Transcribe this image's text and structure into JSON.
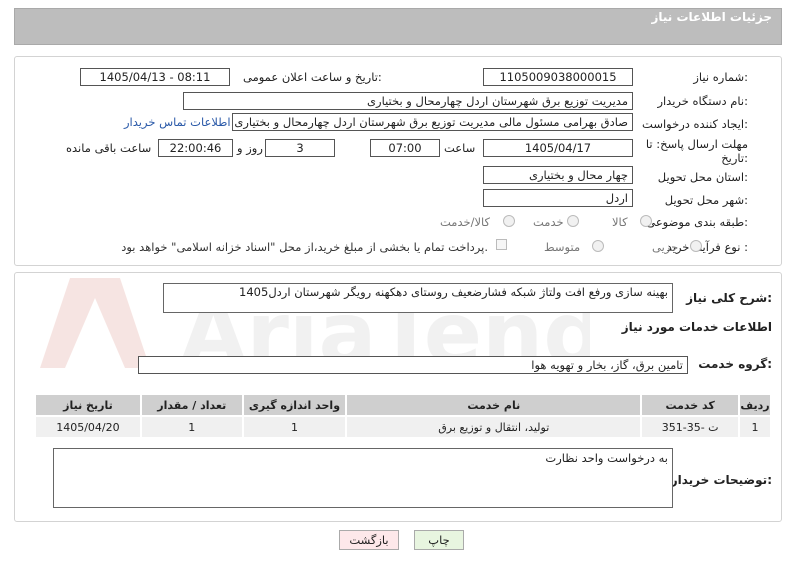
{
  "header": {
    "title": "جزئیات اطلاعات نیاز"
  },
  "watermark": {
    "text": "AriaTender.net"
  },
  "form": {
    "need_number_label": "شماره نیاز:",
    "need_number": "1105009038000015",
    "announce_label": "تاریخ و ساعت اعلان عمومی:",
    "announce_value": "1405/04/13 - 08:11",
    "buyer_org_label": "نام دستگاه خریدار:",
    "buyer_org": "مدیریت توزیع برق شهرستان اردل چهارمحال و بختیاری",
    "creator_label": "ایجاد کننده درخواست:",
    "creator": "صادق بهرامی مسئول مالی مدیریت توزیع برق شهرستان اردل چهارمحال و بختیاری",
    "contact_link": "اطلاعات تماس خریدار",
    "deadline_label": "مهلت ارسال پاسخ: تا تاریخ:",
    "deadline_date": "1405/04/17",
    "time_label": "ساعت",
    "deadline_time": "07:00",
    "days_value": "3",
    "days_label": "روز و",
    "remaining_time": "22:00:46",
    "remaining_label": "ساعت باقی مانده",
    "province_label": "استان محل تحویل:",
    "province": "چهار محال و بختیاری",
    "city_label": "شهر محل تحویل:",
    "city": "اردل",
    "category_label": "طبقه بندی موضوعی:",
    "category_options": [
      "کالا",
      "خدمت",
      "کالا/خدمت"
    ],
    "process_label": "نوع فرآیند خرید :",
    "process_options": [
      "جزیی",
      "متوسط"
    ],
    "payment_note": "پرداخت تمام یا بخشی از مبلغ خرید،از محل \"اسناد خزانه اسلامی\" خواهد بود."
  },
  "summary": {
    "label": "شرح کلی نیاز:",
    "text": "بهینه سازی ورفع افت ولتاژ شبکه فشارضعیف روستای دهکهنه رویگر شهرستان اردل1405"
  },
  "services": {
    "section_title": "اطلاعات خدمات مورد نیاز",
    "group_label": "گروه خدمت:",
    "group_value": "تامین برق، گاز، بخار و تهویه هوا",
    "columns": [
      "ردیف",
      "کد خدمت",
      "نام خدمت",
      "واحد اندازه گیری",
      "تعداد / مقدار",
      "تاریخ نیاز"
    ],
    "rows": [
      {
        "row": "1",
        "code": "ت -35-351",
        "name": "تولید، انتقال و توزیع برق",
        "unit": "1",
        "qty": "1",
        "date": "1405/04/20"
      }
    ]
  },
  "buyer_notes": {
    "label": "توضیحات خریدار:",
    "text": "به درخواست واحد نظارت"
  },
  "buttons": {
    "print": "چاپ",
    "back": "بازگشت"
  },
  "colors": {
    "header_bg": "#bdbdbd",
    "link": "#2a59a8",
    "print_btn": "#e8f5e0",
    "back_btn": "#fde8ea"
  }
}
